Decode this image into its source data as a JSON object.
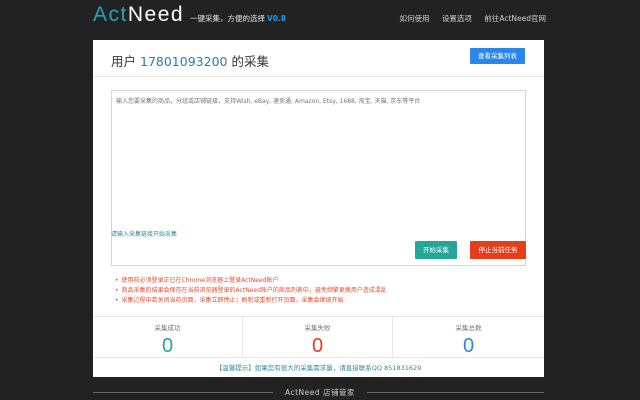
{
  "header": {
    "logo_part1": "Act",
    "logo_part2": "Need",
    "slogan": "一键采集，方便的选择",
    "version": "V0.8",
    "nav": [
      "如何使用",
      "设置选项",
      "前往ActNeed官网"
    ]
  },
  "panel": {
    "title_prefix": "用户",
    "phone": "17801093200",
    "title_suffix": "的采集",
    "list_button": "查看采集列表",
    "input_placeholder": "输入您要采集的商品，分组或店铺链接，支持Wish, eBay, 速卖通, Amazon, Etsy, 1688, 淘宝, 天猫, 京东等平台",
    "hint": "请输入采集链接开始采集",
    "start_button": "开始采集",
    "stop_button": "停止当前任务",
    "notes": [
      "使用前必须登录正已在Chrome浏览器上登录ActNeed账户",
      "商品采集的结果会保存在当前浏览器登录的ActNeed账户的商品列表中，避免频繁更换用户造成混乱",
      "采集过程中若关闭当前页面，采集立即停止；刷新或重新打开页面，采集会继续开始"
    ],
    "stats": [
      {
        "label": "采集成功",
        "value": "0",
        "color": "#26a69a"
      },
      {
        "label": "采集失败",
        "value": "0",
        "color": "#e53e1d"
      },
      {
        "label": "采集总数",
        "value": "0",
        "color": "#2a86e8"
      }
    ],
    "tip": "【温馨提示】如果您有很大的采集需求量，请直接联系QQ 851831629"
  },
  "footer": {
    "text": "ActNeed 店铺管家"
  }
}
